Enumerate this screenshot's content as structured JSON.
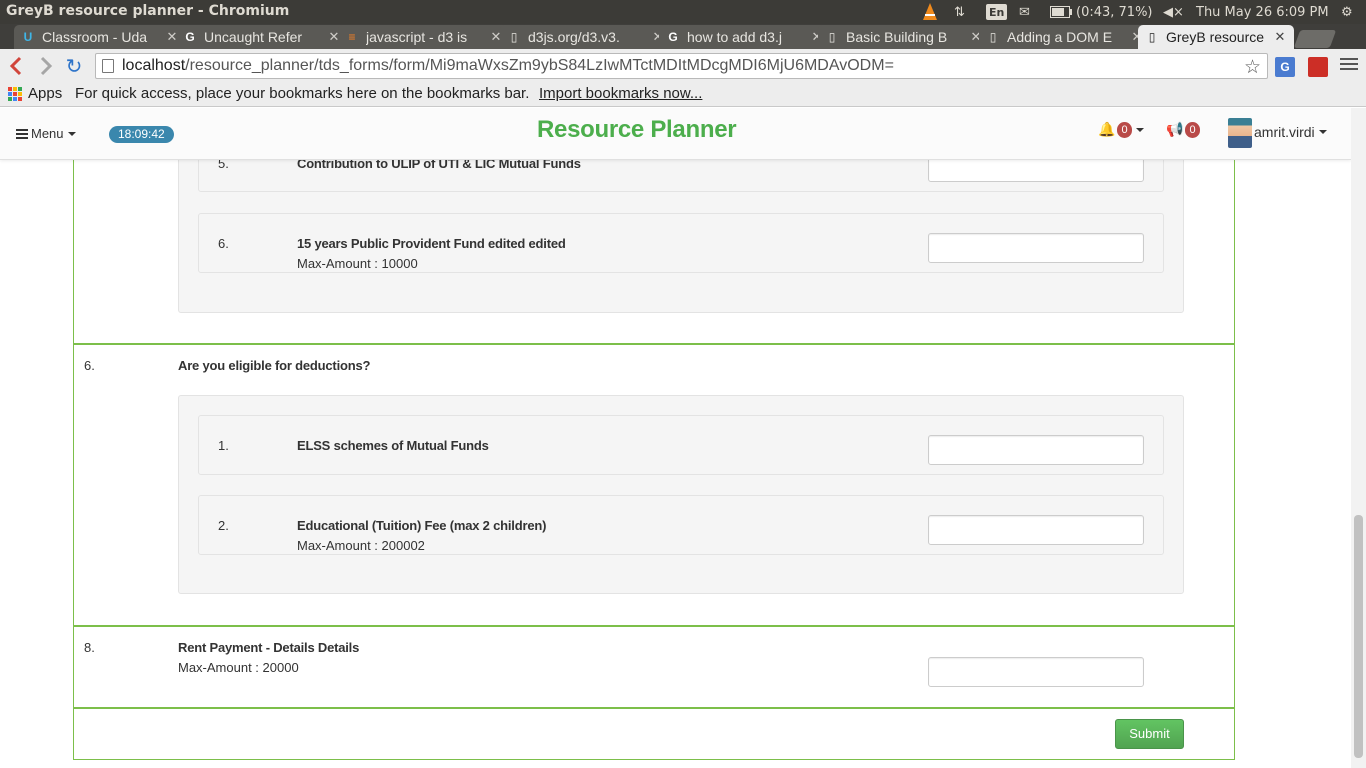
{
  "os": {
    "window_title": "GreyB resource planner - Chromium",
    "lang": "En",
    "battery": "(0:43, 71%)",
    "clock": "Thu May 26  6:09 PM"
  },
  "tabs": [
    {
      "label": "Classroom - Uda",
      "favicon": "udacity-icon"
    },
    {
      "label": "Uncaught Refer",
      "favicon": "google-icon"
    },
    {
      "label": "javascript - d3 is",
      "favicon": "stackoverflow-icon"
    },
    {
      "label": "d3js.org/d3.v3.",
      "favicon": "page-icon"
    },
    {
      "label": "how to add d3.j",
      "favicon": "google-icon"
    },
    {
      "label": "Basic Building B",
      "favicon": "page-icon"
    },
    {
      "label": "Adding a DOM E",
      "favicon": "page-icon"
    },
    {
      "label": "GreyB resource",
      "favicon": "page-icon",
      "active": true
    }
  ],
  "toolbar": {
    "url_host": "localhost",
    "url_path": "/resource_planner/tds_forms/form/Mi9maWxsZm9ybS84LzIwMTctMDItMDcgMDI6MjU6MDAvODM="
  },
  "bookmarks": {
    "apps": "Apps",
    "hint": "For quick access, place your bookmarks here on the bookmarks bar.",
    "import": "Import bookmarks now..."
  },
  "navbar": {
    "menu": "Menu",
    "time": "18:09:42",
    "brand": "Resource Planner",
    "notifications": "0",
    "announcements": "0",
    "user": "amrit.virdi"
  },
  "form": {
    "items_top": [
      {
        "num": "5.",
        "title": "Contribution to ULIP of UTI & LIC Mutual Funds",
        "max": ""
      },
      {
        "num": "6.",
        "title": "15 years Public Provident Fund edited edited",
        "max": "Max-Amount : 10000"
      }
    ],
    "section6": {
      "num": "6.",
      "title": "Are you eligible for deductions?",
      "items": [
        {
          "num": "1.",
          "title": "ELSS schemes of Mutual Funds",
          "max": ""
        },
        {
          "num": "2.",
          "title": "Educational (Tuition) Fee (max 2 children)",
          "max": "Max-Amount : 200002"
        }
      ]
    },
    "section8": {
      "num": "8.",
      "title": "Rent Payment - Details Details",
      "max": "Max-Amount : 20000"
    },
    "submit": "Submit"
  },
  "colors": {
    "accent_green": "#4cae4c",
    "frame_green": "#7cbf4a",
    "badge_blue": "#3a87ad",
    "badge_red": "#b94a48"
  }
}
